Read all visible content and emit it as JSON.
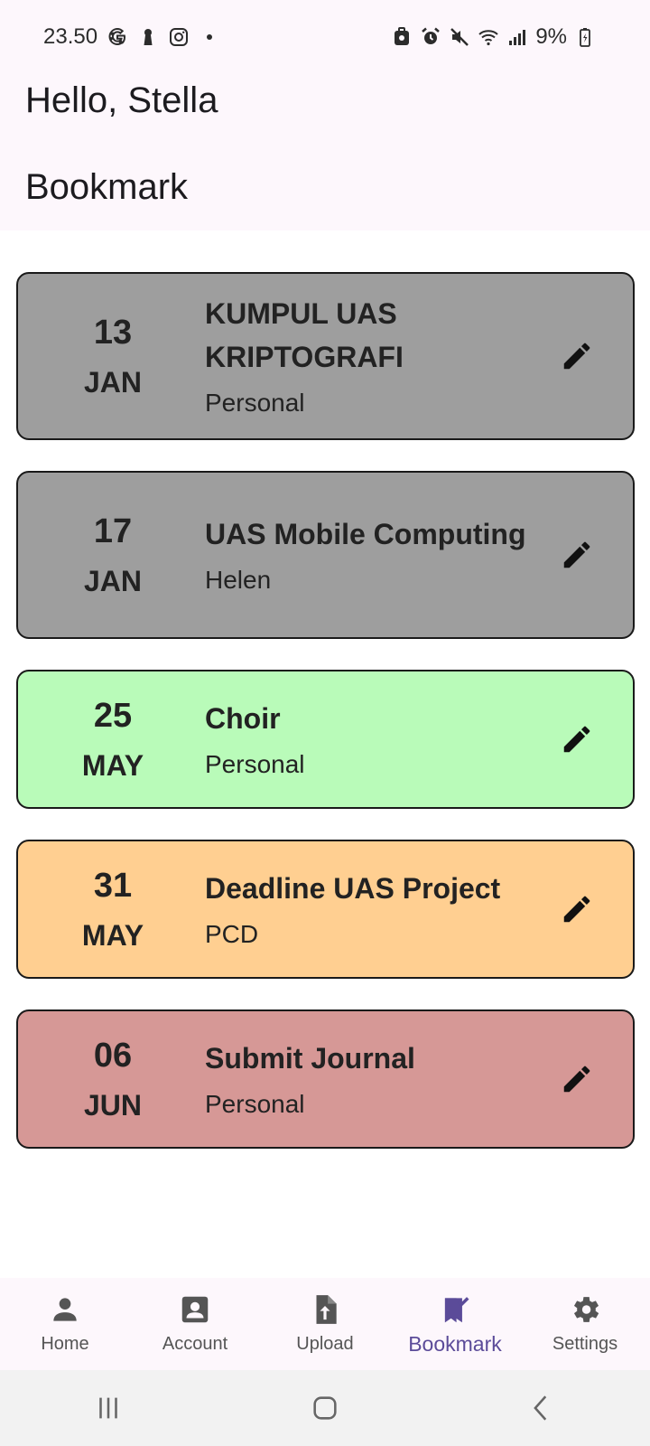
{
  "status_bar": {
    "time": "23.50",
    "battery": "9%"
  },
  "header": {
    "greeting": "Hello, Stella",
    "title": "Bookmark"
  },
  "events": [
    {
      "day": "13",
      "month": "JAN",
      "title": "KUMPUL UAS KRIPTOGRAFI",
      "category": "Personal",
      "color": "#9e9e9e"
    },
    {
      "day": "17",
      "month": "JAN",
      "title": "UAS Mobile Computing",
      "category": "Helen",
      "color": "#9e9e9e"
    },
    {
      "day": "25",
      "month": "MAY",
      "title": "Choir",
      "category": "Personal",
      "color": "#b9fbb9"
    },
    {
      "day": "31",
      "month": "MAY",
      "title": "Deadline UAS Project",
      "category": "PCD",
      "color": "#ffcf91"
    },
    {
      "day": "06",
      "month": "JUN",
      "title": "Submit Journal",
      "category": "Personal",
      "color": "#d69896"
    }
  ],
  "nav": {
    "items": [
      {
        "label": "Home",
        "icon": "person-icon"
      },
      {
        "label": "Account",
        "icon": "account-box-icon"
      },
      {
        "label": "Upload",
        "icon": "upload-file-icon"
      },
      {
        "label": "Bookmark",
        "icon": "bookmark-added-icon",
        "active": true
      },
      {
        "label": "Settings",
        "icon": "gear-icon"
      }
    ],
    "active_color": "#5b4b99"
  }
}
